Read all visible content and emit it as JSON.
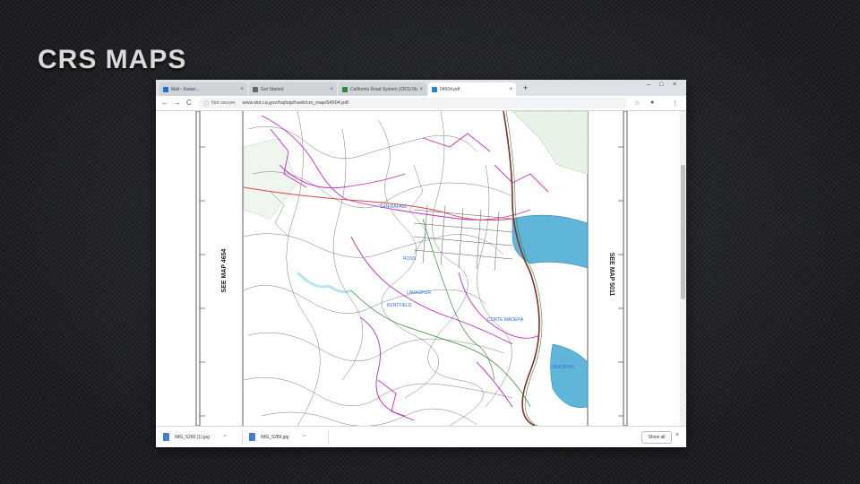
{
  "slide": {
    "title": "CRS MAPS"
  },
  "browser": {
    "tabs": [
      {
        "label": "Mail - Kaiser...",
        "favicon_color": "#1f6fd1",
        "active": false
      },
      {
        "label": "Get Started",
        "favicon_color": "#666666",
        "active": false
      },
      {
        "label": "California Road System (CRS) Ma...",
        "favicon_color": "#2a8a3e",
        "active": false
      },
      {
        "label": "04504.pdf",
        "favicon_color": "#2f7bd8",
        "active": true
      }
    ],
    "new_tab_symbol": "+",
    "window_controls": [
      "–",
      "□",
      "×"
    ],
    "nav": {
      "back": "←",
      "forward": "→",
      "reload": "C",
      "home": "⌂"
    },
    "address": {
      "security_label": "Not secure",
      "url": "www.dot.ca.gov/hq/tsip/hseb/crs_map/04504.pdf"
    },
    "toolbar_icons": [
      "☆",
      "●",
      "⋮"
    ]
  },
  "pdf": {
    "see_map_left": "SEE MAP 4654",
    "see_map_right": "SEE MAP 5011",
    "map_labels": [
      "SAN RAFAEL",
      "ROSS",
      "LARKSPUR",
      "KENTFIELD",
      "CORTE MADERA",
      "LARKSPUR"
    ]
  },
  "downloads": {
    "items": [
      {
        "label": "IMG_5290 (1).jpg"
      },
      {
        "label": "IMG_5289.jpg"
      }
    ],
    "show_all_label": "Show all",
    "close_symbol": "×"
  }
}
